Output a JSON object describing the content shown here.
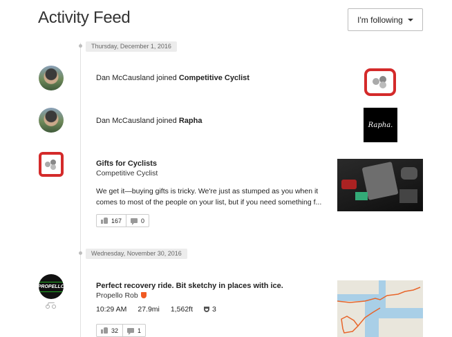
{
  "header": {
    "title": "Activity Feed",
    "filter_label": "I'm following"
  },
  "dates": [
    "Thursday, December 1, 2016",
    "Wednesday, November 30, 2016"
  ],
  "feed": {
    "join1": {
      "user": "Dan McCausland",
      "verb": " joined ",
      "club": "Competitive Cyclist"
    },
    "join2": {
      "user": "Dan McCausland",
      "verb": " joined ",
      "club": "Rapha"
    },
    "rapha_logo": "Rapha.",
    "post": {
      "title": "Gifts for Cyclists",
      "club": "Competitive Cyclist",
      "body": "We get it—buying gifts is tricky. We're just as stumped as you when it comes to most of the people on your list, but if you need something f...",
      "kudos": "167",
      "comments": "0"
    },
    "activity": {
      "title": "Perfect recovery ride. Bit sketchy in places with ice.",
      "athlete": "Propello Rob",
      "avatar_text": "PROPELLO",
      "time": "10:29 AM",
      "distance": "27.9mi",
      "elevation": "1,562ft",
      "achievements": "3",
      "kudos": "32",
      "comments": "1"
    }
  },
  "colors": {
    "club_red": "#d42a2a",
    "shield_orange": "#f05a22"
  },
  "icons": [
    "caret-down-icon",
    "thumbs-up-icon",
    "comment-icon",
    "trophy-icon",
    "shield-icon",
    "bike-icon"
  ]
}
